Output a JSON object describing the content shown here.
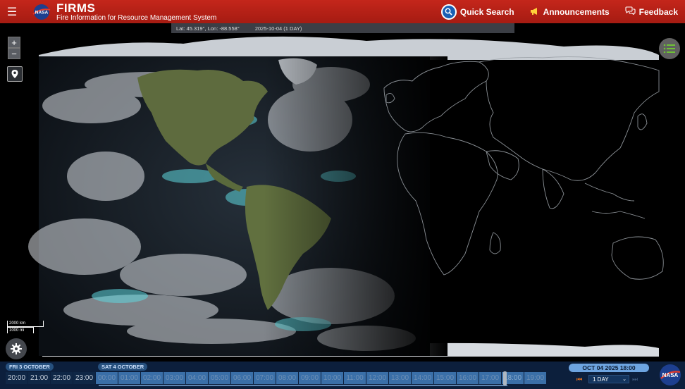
{
  "header": {
    "brand_title": "FIRMS",
    "brand_subtitle": "Fire Information for Resource Management System",
    "quick_search": "Quick Search",
    "announcements": "Announcements",
    "feedback": "Feedback",
    "logo_text": "NASA"
  },
  "coord_bar": {
    "latlon": "Lat: 45.319°, Lon: -88.558°",
    "date_range": "2025-10-04 (1 DAY)"
  },
  "map": {
    "zoom_in": "+",
    "zoom_out": "−",
    "scale_km": "2000 km",
    "scale_mi": "1000 mi"
  },
  "timeline": {
    "days": [
      {
        "label": "FRI 3 OCTOBER"
      },
      {
        "label": "SAT 4 OCTOBER"
      }
    ],
    "hours": [
      "20:00",
      "21:00",
      "22:00",
      "23:00",
      "00:00",
      "01:00",
      "02:00",
      "03:00",
      "04:00",
      "05:00",
      "06:00",
      "07:00",
      "08:00",
      "09:00",
      "10:00",
      "11:00",
      "12:00",
      "13:00",
      "14:00",
      "15:00",
      "16:00",
      "17:00",
      "18:00",
      "19:00"
    ],
    "current_hour_index": 22,
    "selected_datetime": "OCT 04 2025 18:00",
    "range": "1 DAY"
  },
  "colors": {
    "header_red": "#b22116",
    "accent_blue": "#1a5fb4",
    "timeline_bg": "#0c1f3c"
  }
}
